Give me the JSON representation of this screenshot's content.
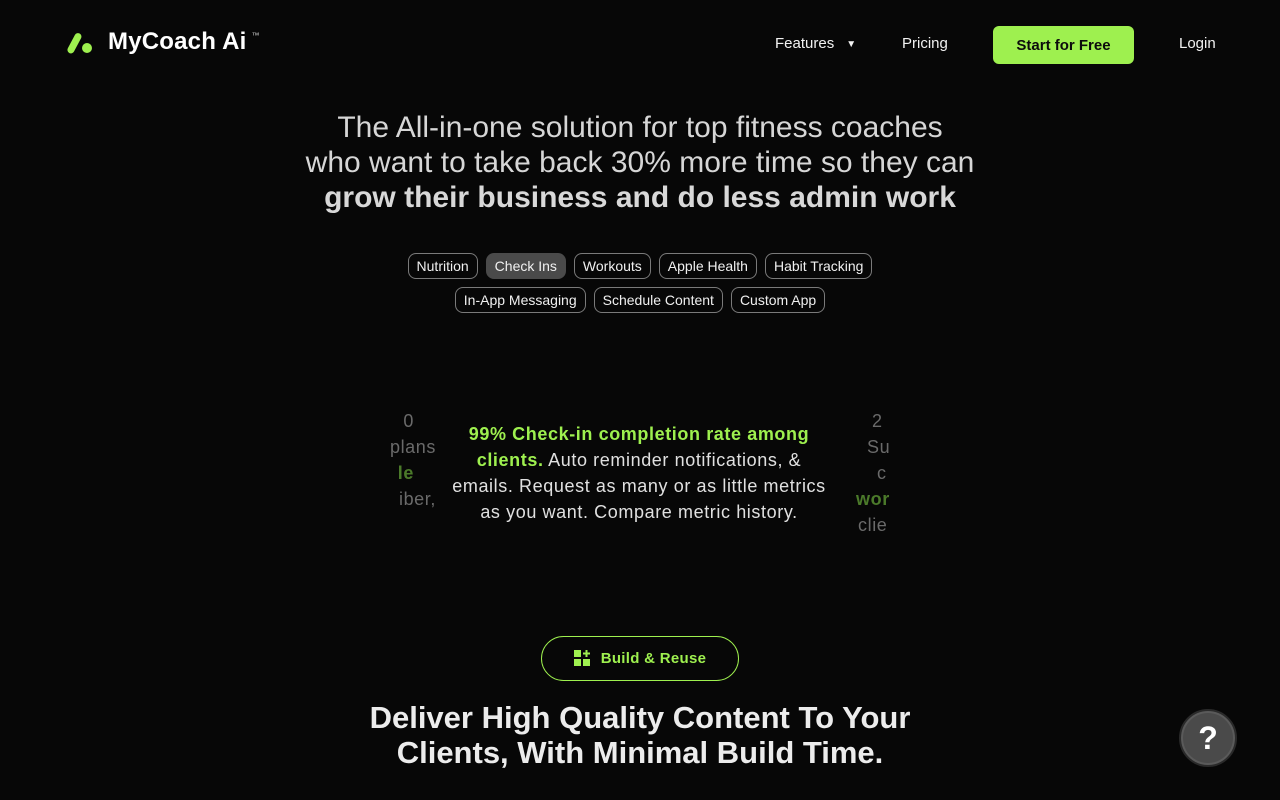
{
  "brand": {
    "name": "MyCoach Ai",
    "tm": "™",
    "accent": "#9ef04f"
  },
  "nav": {
    "features": "Features",
    "pricing": "Pricing",
    "cta": "Start for Free",
    "login": "Login"
  },
  "hero": {
    "line1": "The All-in-one solution for top fitness coaches",
    "line2": "who want to take back 30% more time so they can",
    "line3": "grow their business and do less admin work"
  },
  "tags": {
    "row1": [
      "Nutrition",
      "Check Ins",
      "Workouts",
      "Apple Health",
      "Habit Tracking"
    ],
    "row2": [
      "In-App Messaging",
      "Schedule Content",
      "Custom App"
    ],
    "active": "Check Ins"
  },
  "carousel": {
    "center": {
      "highlight": "99% Check-in completion rate among clients.",
      "body": " Auto reminder notifications, & emails. Request as many or as little metrics as you want. Compare metric history."
    },
    "left_partial": {
      "l1": "0",
      "l2": "plans",
      "l3": "le",
      "l4": "iber,"
    },
    "right_partial": {
      "l1": "2",
      "l2": "Su",
      "l3": "c",
      "l4": "wor",
      "l5": "clie"
    }
  },
  "section": {
    "pill": "Build & Reuse",
    "title1": "Deliver High Quality Content To Your",
    "title2": "Clients, With Minimal Build Time."
  },
  "help": {
    "label": "?"
  }
}
